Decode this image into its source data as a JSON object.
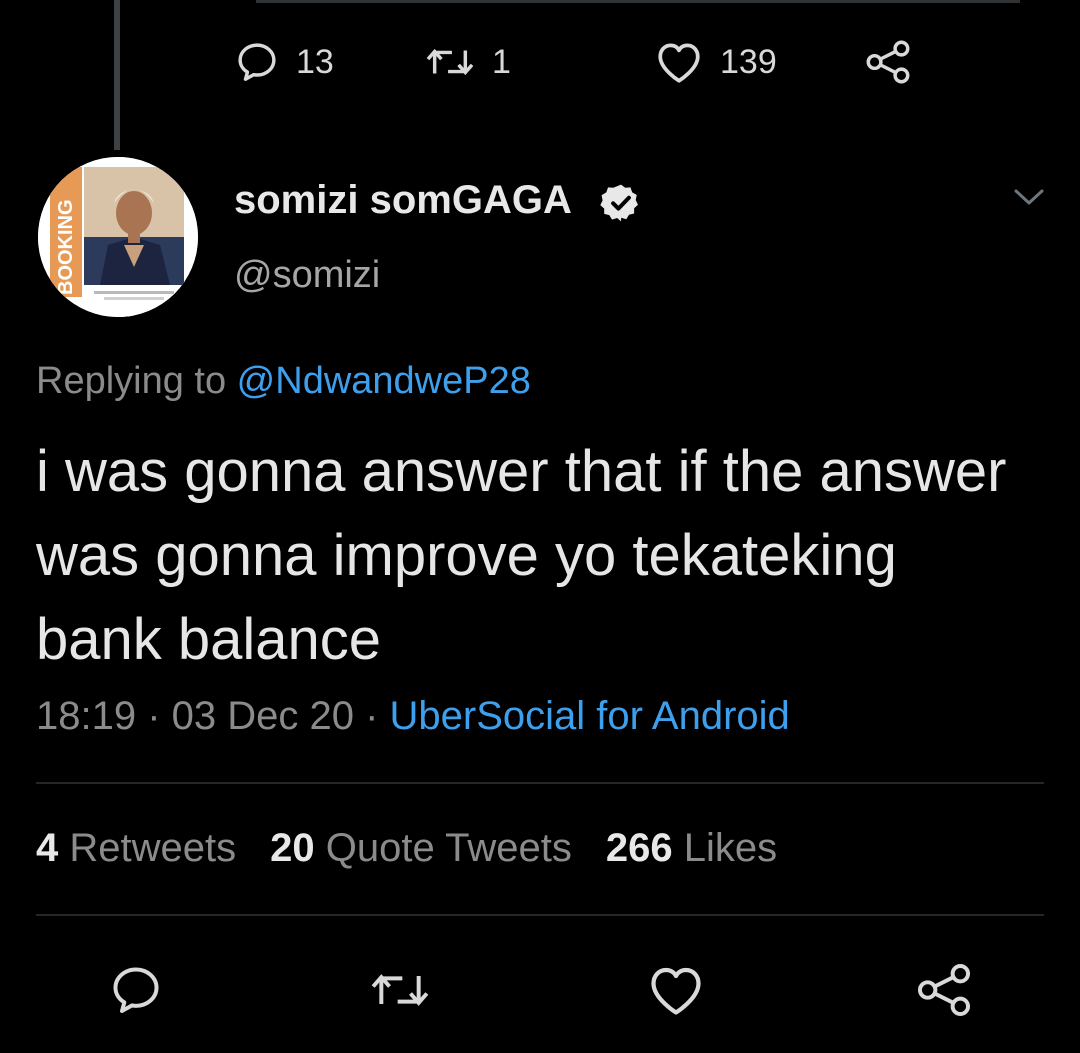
{
  "previous_tweet": {
    "reply_count": "13",
    "retweet_count": "1",
    "like_count": "139"
  },
  "author": {
    "display_name": "somizi somGAGA",
    "handle": "@somizi",
    "verified_icon": "verified-badge-icon",
    "avatar_text": "BOOKING"
  },
  "reply_context": {
    "prefix": "Replying to ",
    "mention": "@NdwandweP28"
  },
  "tweet": {
    "text": "i was gonna answer that if the answer was gonna improve yo tekateking bank balance",
    "time": "18:19",
    "date": "03 Dec 20",
    "separator": " · ",
    "source": "UberSocial for Android"
  },
  "stats": {
    "retweets_count": "4",
    "retweets_label": "Retweets",
    "quotes_count": "20",
    "quotes_label": "Quote Tweets",
    "likes_count": "266",
    "likes_label": "Likes"
  },
  "icons": {
    "reply": "reply-icon",
    "retweet": "retweet-icon",
    "like": "heart-icon",
    "share": "share-icon",
    "more": "chevron-down-icon"
  },
  "colors": {
    "background": "#000000",
    "accent": "#3ea0ec",
    "muted": "#8b8b8b",
    "text": "#e6e6e6"
  }
}
